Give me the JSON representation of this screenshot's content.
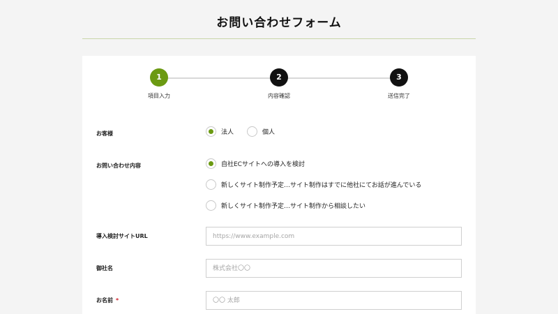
{
  "header": {
    "title": "お問い合わせフォーム"
  },
  "steps": [
    {
      "number": "1",
      "label": "項目入力"
    },
    {
      "number": "2",
      "label": "内容確認"
    },
    {
      "number": "3",
      "label": "送信完了"
    }
  ],
  "form": {
    "customer_type": {
      "label": "お客様",
      "options": [
        "法人",
        "個人"
      ]
    },
    "inquiry": {
      "label": "お問い合わせ内容",
      "options": [
        "自社ECサイトへの導入を検討",
        "新しくサイト制作予定…サイト制作はすでに他社にてお話が進んでいる",
        "新しくサイト制作予定…サイト制作から相談したい"
      ]
    },
    "site_url": {
      "label": "導入検討サイトURL",
      "placeholder": "https://www.example.com"
    },
    "company": {
      "label": "御社名",
      "placeholder": "株式会社〇〇"
    },
    "name": {
      "label": "お名前",
      "required_mark": "*",
      "placeholder": "〇〇 太郎"
    }
  },
  "colors": {
    "accent": "#6b9a12",
    "step_inactive": "#111111",
    "required": "#d0202a"
  }
}
